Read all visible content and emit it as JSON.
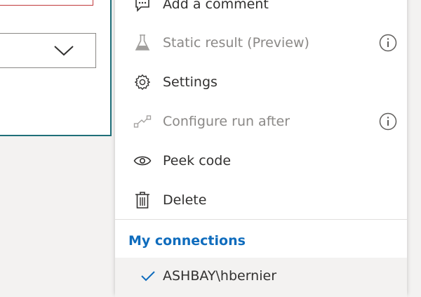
{
  "menu": {
    "items": [
      {
        "label": "Add a comment",
        "icon": "comment-icon",
        "disabled": false
      },
      {
        "label": "Static result (Preview)",
        "icon": "flask-icon",
        "disabled": true,
        "info": true
      },
      {
        "label": "Settings",
        "icon": "gear-icon",
        "disabled": false
      },
      {
        "label": "Configure run after",
        "icon": "run-after-icon",
        "disabled": true,
        "info": true
      },
      {
        "label": "Peek code",
        "icon": "eye-icon",
        "disabled": false
      },
      {
        "label": "Delete",
        "icon": "trash-icon",
        "disabled": false
      }
    ],
    "connections_title": "My connections",
    "connections": [
      {
        "label": "ASHBAY\\hbernier",
        "selected": true
      }
    ]
  },
  "colors": {
    "accent": "#0f6cbd",
    "card_border": "#1f6f78",
    "error_border": "#c0393b",
    "disabled_text": "#8a8886"
  }
}
